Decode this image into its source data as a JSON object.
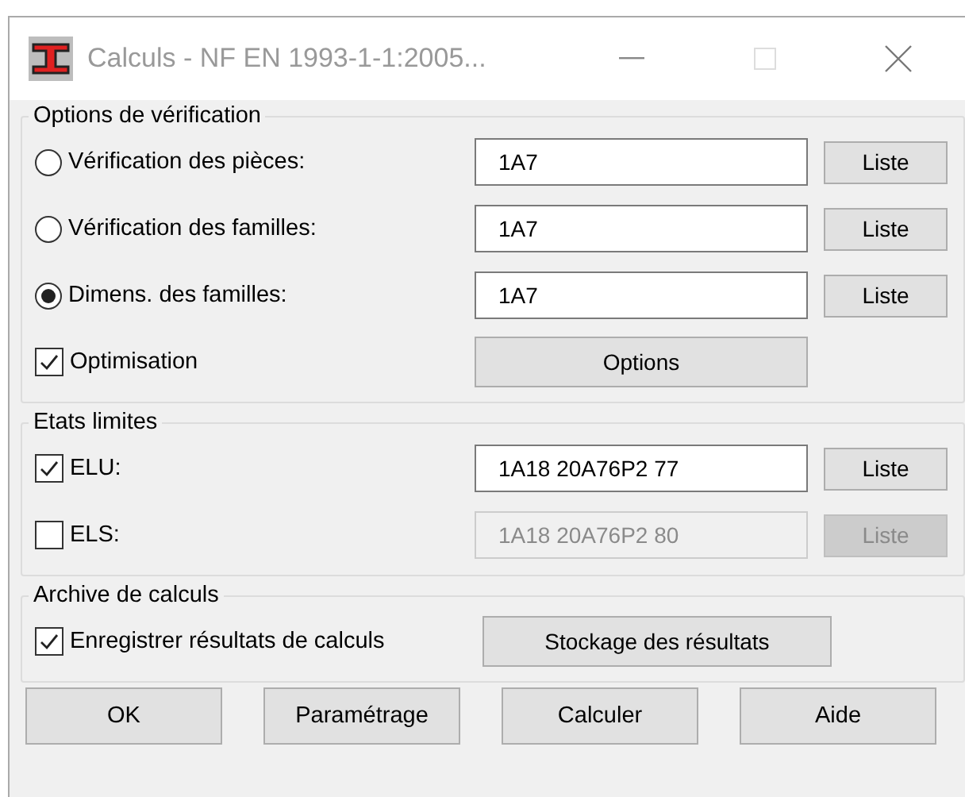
{
  "window": {
    "title": "Calculs - NF EN 1993-1-1:2005..."
  },
  "groups": [
    {
      "title": "Options de vérification",
      "rows": [
        {
          "kind": "radio",
          "label": "Vérification des pièces:",
          "selected": false,
          "disabled": false,
          "field": "1A7",
          "button": "Liste"
        },
        {
          "kind": "radio",
          "label": "Vérification des familles:",
          "selected": false,
          "disabled": false,
          "field": "1A7",
          "button": "Liste"
        },
        {
          "kind": "radio",
          "label": "Dimens. des familles:",
          "selected": true,
          "disabled": false,
          "field": "1A7",
          "button": "Liste"
        },
        {
          "kind": "checkbox",
          "label": "Optimisation",
          "checked": true,
          "wide_button": "Options"
        }
      ]
    },
    {
      "title": "Etats limites",
      "rows": [
        {
          "kind": "checkbox",
          "label": "ELU:",
          "checked": true,
          "disabled": false,
          "field": "1A18 20A76P2 77",
          "button": "Liste"
        },
        {
          "kind": "checkbox",
          "label": "ELS:",
          "checked": false,
          "disabled": true,
          "field": "1A18 20A76P2 80",
          "button": "Liste"
        }
      ]
    },
    {
      "title": "Archive de calculs",
      "rows": [
        {
          "kind": "checkbox",
          "label": "Enregistrer résultats de calculs",
          "checked": true,
          "wide_button": "Stockage des résultats"
        }
      ]
    }
  ],
  "buttons": [
    "OK",
    "Paramétrage",
    "Calculer",
    "Aide"
  ]
}
